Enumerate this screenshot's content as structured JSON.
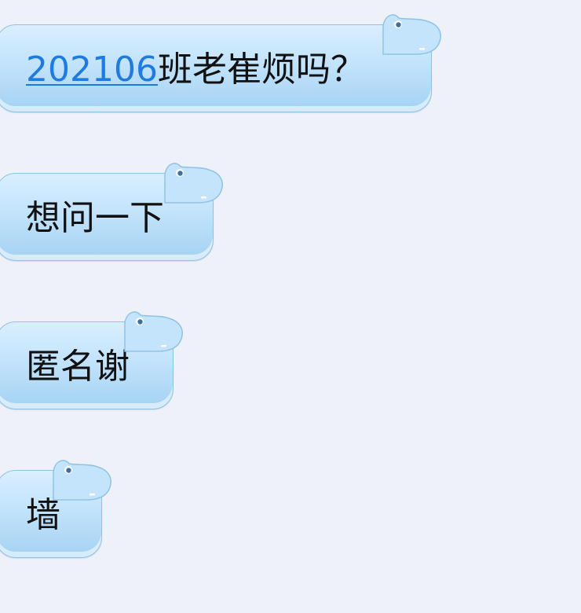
{
  "messages": [
    {
      "link_text": "202106",
      "text": "班老崔烦吗？"
    },
    {
      "text": "想问一下"
    },
    {
      "text": "匿名谢"
    },
    {
      "text": "墙"
    }
  ],
  "colors": {
    "background": "#eff1f8",
    "bubble_top": "#d9efff",
    "bubble_bottom": "#a4d2f3",
    "bubble_border": "#8fc3e6",
    "link": "#1e7be0",
    "text": "#111111"
  },
  "icons": {
    "bubble_decoration": "hippo-head-icon"
  }
}
